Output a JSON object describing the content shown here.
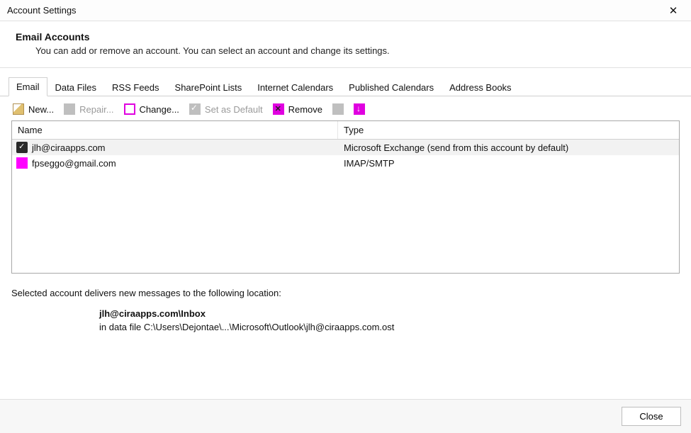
{
  "title": "Account Settings",
  "header": {
    "title": "Email Accounts",
    "subtitle": "You can add or remove an account. You can select an account and change its settings."
  },
  "tabs": [
    {
      "label": "Email",
      "active": true
    },
    {
      "label": "Data Files"
    },
    {
      "label": "RSS Feeds"
    },
    {
      "label": "SharePoint Lists"
    },
    {
      "label": "Internet Calendars"
    },
    {
      "label": "Published Calendars"
    },
    {
      "label": "Address Books"
    }
  ],
  "toolbar": {
    "new_label": "New...",
    "repair_label": "Repair...",
    "change_label": "Change...",
    "default_label": "Set as Default",
    "remove_label": "Remove"
  },
  "columns": {
    "name": "Name",
    "type": "Type"
  },
  "accounts": [
    {
      "name": "jlh@ciraapps.com",
      "type": "Microsoft Exchange (send from this account by default)",
      "default": true
    },
    {
      "name": "fpseggo@gmail.com",
      "type": "IMAP/SMTP",
      "default": false
    }
  ],
  "delivery": {
    "intro": "Selected account delivers new messages to the following location:",
    "folder": "jlh@ciraapps.com\\Inbox",
    "path": "in data file C:\\Users\\Dejontae\\...\\Microsoft\\Outlook\\jlh@ciraapps.com.ost"
  },
  "footer": {
    "close_label": "Close"
  }
}
